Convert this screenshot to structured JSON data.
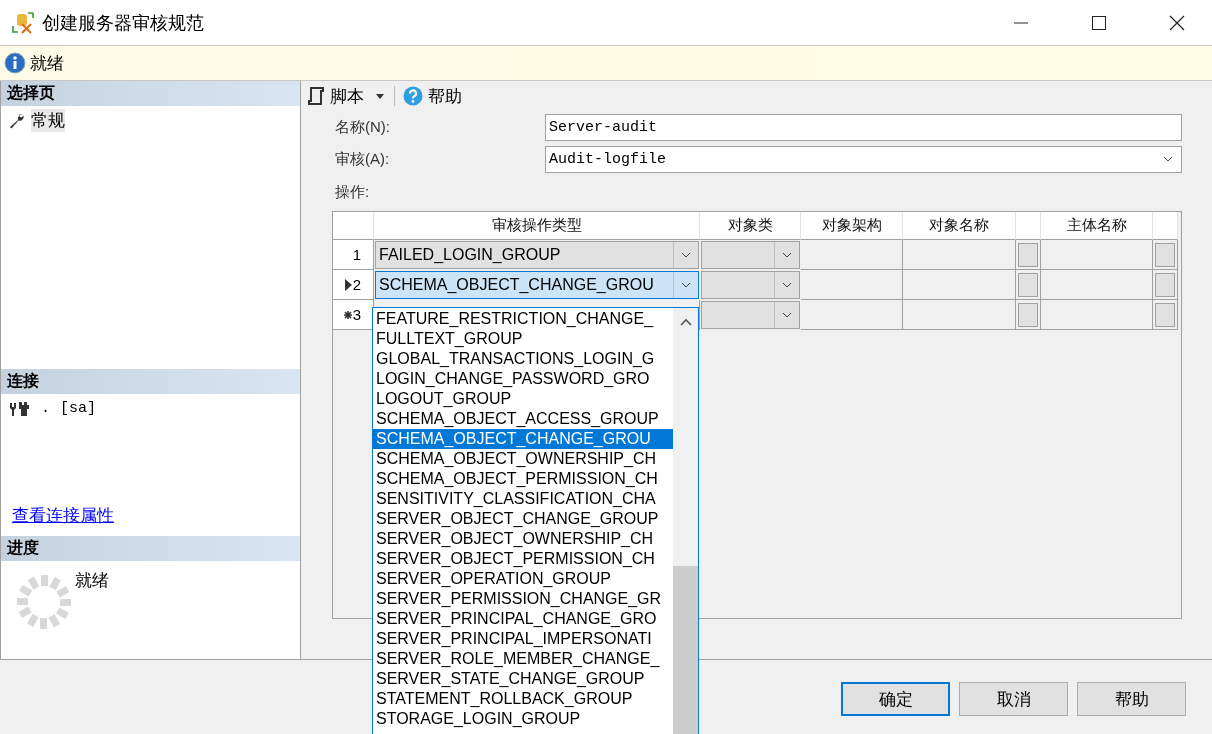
{
  "window": {
    "title": "创建服务器审核规范"
  },
  "info_bar": {
    "text": "就绪"
  },
  "select_page": {
    "title": "选择页",
    "items": [
      {
        "label": "常规",
        "selected": true
      }
    ]
  },
  "connection": {
    "title": "连接",
    "server": ".",
    "user": "[sa]",
    "link": "查看连接属性"
  },
  "progress": {
    "title": "进度",
    "status": "就绪"
  },
  "toolbar": [
    {
      "label": "脚本",
      "kind": "script"
    },
    {
      "label": "帮助",
      "kind": "help"
    }
  ],
  "form": [
    {
      "label": "名称(N):",
      "value": "Server-audit",
      "kind": "text"
    },
    {
      "label": "审核(A):",
      "value": "Audit-logfile",
      "kind": "combo"
    }
  ],
  "actions": {
    "label": "操作:",
    "columns": [
      "审核操作类型",
      "对象类",
      "对象架构",
      "对象名称",
      "主体名称"
    ],
    "rows": [
      {
        "number": "1",
        "new": false,
        "type": "FAILED_LOGIN_GROUP",
        "selected": false
      },
      {
        "number": "2",
        "new": false,
        "type": "SCHEMA_OBJECT_CHANGE_GROU",
        "selected": true
      },
      {
        "number": "3",
        "new": true,
        "selected": false
      }
    ]
  },
  "dropdown": {
    "items": [
      {
        "label": "FEATURE_RESTRICTION_CHANGE_",
        "selected": false
      },
      {
        "label": "FULLTEXT_GROUP",
        "selected": false
      },
      {
        "label": "GLOBAL_TRANSACTIONS_LOGIN_G",
        "selected": false
      },
      {
        "label": "LOGIN_CHANGE_PASSWORD_GRO",
        "selected": false
      },
      {
        "label": "LOGOUT_GROUP",
        "selected": false
      },
      {
        "label": "SCHEMA_OBJECT_ACCESS_GROUP",
        "selected": false
      },
      {
        "label": "SCHEMA_OBJECT_CHANGE_GROU",
        "selected": true
      },
      {
        "label": "SCHEMA_OBJECT_OWNERSHIP_CH",
        "selected": false
      },
      {
        "label": "SCHEMA_OBJECT_PERMISSION_CH",
        "selected": false
      },
      {
        "label": "SENSITIVITY_CLASSIFICATION_CHA",
        "selected": false
      },
      {
        "label": "SERVER_OBJECT_CHANGE_GROUP",
        "selected": false
      },
      {
        "label": "SERVER_OBJECT_OWNERSHIP_CH",
        "selected": false
      },
      {
        "label": "SERVER_OBJECT_PERMISSION_CH",
        "selected": false
      },
      {
        "label": "SERVER_OPERATION_GROUP",
        "selected": false
      },
      {
        "label": "SERVER_PERMISSION_CHANGE_GR",
        "selected": false
      },
      {
        "label": "SERVER_PRINCIPAL_CHANGE_GRO",
        "selected": false
      },
      {
        "label": "SERVER_PRINCIPAL_IMPERSONATI",
        "selected": false
      },
      {
        "label": "SERVER_ROLE_MEMBER_CHANGE_",
        "selected": false
      },
      {
        "label": "SERVER_STATE_CHANGE_GROUP",
        "selected": false
      },
      {
        "label": "STATEMENT_ROLLBACK_GROUP",
        "selected": false
      },
      {
        "label": "STORAGE_LOGIN_GROUP",
        "selected": false
      }
    ]
  },
  "buttons": [
    {
      "label": "确定",
      "kind": "default"
    },
    {
      "label": "取消",
      "kind": "normal"
    },
    {
      "label": "帮助",
      "kind": "normal"
    }
  ]
}
